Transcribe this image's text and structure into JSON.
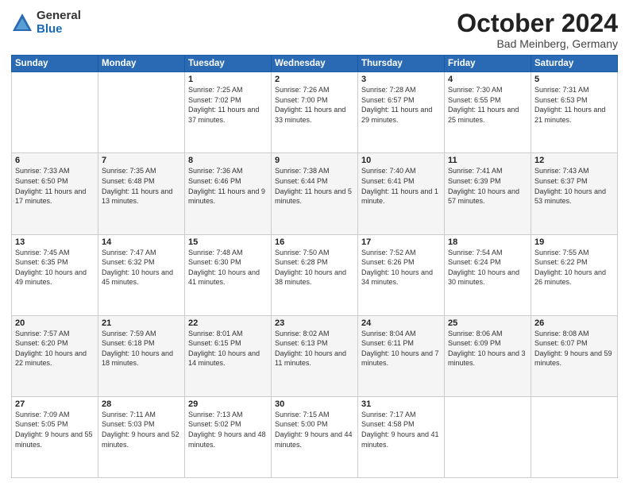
{
  "logo": {
    "general": "General",
    "blue": "Blue"
  },
  "title": {
    "month": "October 2024",
    "location": "Bad Meinberg, Germany"
  },
  "weekdays": [
    "Sunday",
    "Monday",
    "Tuesday",
    "Wednesday",
    "Thursday",
    "Friday",
    "Saturday"
  ],
  "weeks": [
    [
      {
        "day": "",
        "info": ""
      },
      {
        "day": "",
        "info": ""
      },
      {
        "day": "1",
        "info": "Sunrise: 7:25 AM\nSunset: 7:02 PM\nDaylight: 11 hours and 37 minutes."
      },
      {
        "day": "2",
        "info": "Sunrise: 7:26 AM\nSunset: 7:00 PM\nDaylight: 11 hours and 33 minutes."
      },
      {
        "day": "3",
        "info": "Sunrise: 7:28 AM\nSunset: 6:57 PM\nDaylight: 11 hours and 29 minutes."
      },
      {
        "day": "4",
        "info": "Sunrise: 7:30 AM\nSunset: 6:55 PM\nDaylight: 11 hours and 25 minutes."
      },
      {
        "day": "5",
        "info": "Sunrise: 7:31 AM\nSunset: 6:53 PM\nDaylight: 11 hours and 21 minutes."
      }
    ],
    [
      {
        "day": "6",
        "info": "Sunrise: 7:33 AM\nSunset: 6:50 PM\nDaylight: 11 hours and 17 minutes."
      },
      {
        "day": "7",
        "info": "Sunrise: 7:35 AM\nSunset: 6:48 PM\nDaylight: 11 hours and 13 minutes."
      },
      {
        "day": "8",
        "info": "Sunrise: 7:36 AM\nSunset: 6:46 PM\nDaylight: 11 hours and 9 minutes."
      },
      {
        "day": "9",
        "info": "Sunrise: 7:38 AM\nSunset: 6:44 PM\nDaylight: 11 hours and 5 minutes."
      },
      {
        "day": "10",
        "info": "Sunrise: 7:40 AM\nSunset: 6:41 PM\nDaylight: 11 hours and 1 minute."
      },
      {
        "day": "11",
        "info": "Sunrise: 7:41 AM\nSunset: 6:39 PM\nDaylight: 10 hours and 57 minutes."
      },
      {
        "day": "12",
        "info": "Sunrise: 7:43 AM\nSunset: 6:37 PM\nDaylight: 10 hours and 53 minutes."
      }
    ],
    [
      {
        "day": "13",
        "info": "Sunrise: 7:45 AM\nSunset: 6:35 PM\nDaylight: 10 hours and 49 minutes."
      },
      {
        "day": "14",
        "info": "Sunrise: 7:47 AM\nSunset: 6:32 PM\nDaylight: 10 hours and 45 minutes."
      },
      {
        "day": "15",
        "info": "Sunrise: 7:48 AM\nSunset: 6:30 PM\nDaylight: 10 hours and 41 minutes."
      },
      {
        "day": "16",
        "info": "Sunrise: 7:50 AM\nSunset: 6:28 PM\nDaylight: 10 hours and 38 minutes."
      },
      {
        "day": "17",
        "info": "Sunrise: 7:52 AM\nSunset: 6:26 PM\nDaylight: 10 hours and 34 minutes."
      },
      {
        "day": "18",
        "info": "Sunrise: 7:54 AM\nSunset: 6:24 PM\nDaylight: 10 hours and 30 minutes."
      },
      {
        "day": "19",
        "info": "Sunrise: 7:55 AM\nSunset: 6:22 PM\nDaylight: 10 hours and 26 minutes."
      }
    ],
    [
      {
        "day": "20",
        "info": "Sunrise: 7:57 AM\nSunset: 6:20 PM\nDaylight: 10 hours and 22 minutes."
      },
      {
        "day": "21",
        "info": "Sunrise: 7:59 AM\nSunset: 6:18 PM\nDaylight: 10 hours and 18 minutes."
      },
      {
        "day": "22",
        "info": "Sunrise: 8:01 AM\nSunset: 6:15 PM\nDaylight: 10 hours and 14 minutes."
      },
      {
        "day": "23",
        "info": "Sunrise: 8:02 AM\nSunset: 6:13 PM\nDaylight: 10 hours and 11 minutes."
      },
      {
        "day": "24",
        "info": "Sunrise: 8:04 AM\nSunset: 6:11 PM\nDaylight: 10 hours and 7 minutes."
      },
      {
        "day": "25",
        "info": "Sunrise: 8:06 AM\nSunset: 6:09 PM\nDaylight: 10 hours and 3 minutes."
      },
      {
        "day": "26",
        "info": "Sunrise: 8:08 AM\nSunset: 6:07 PM\nDaylight: 9 hours and 59 minutes."
      }
    ],
    [
      {
        "day": "27",
        "info": "Sunrise: 7:09 AM\nSunset: 5:05 PM\nDaylight: 9 hours and 55 minutes."
      },
      {
        "day": "28",
        "info": "Sunrise: 7:11 AM\nSunset: 5:03 PM\nDaylight: 9 hours and 52 minutes."
      },
      {
        "day": "29",
        "info": "Sunrise: 7:13 AM\nSunset: 5:02 PM\nDaylight: 9 hours and 48 minutes."
      },
      {
        "day": "30",
        "info": "Sunrise: 7:15 AM\nSunset: 5:00 PM\nDaylight: 9 hours and 44 minutes."
      },
      {
        "day": "31",
        "info": "Sunrise: 7:17 AM\nSunset: 4:58 PM\nDaylight: 9 hours and 41 minutes."
      },
      {
        "day": "",
        "info": ""
      },
      {
        "day": "",
        "info": ""
      }
    ]
  ]
}
